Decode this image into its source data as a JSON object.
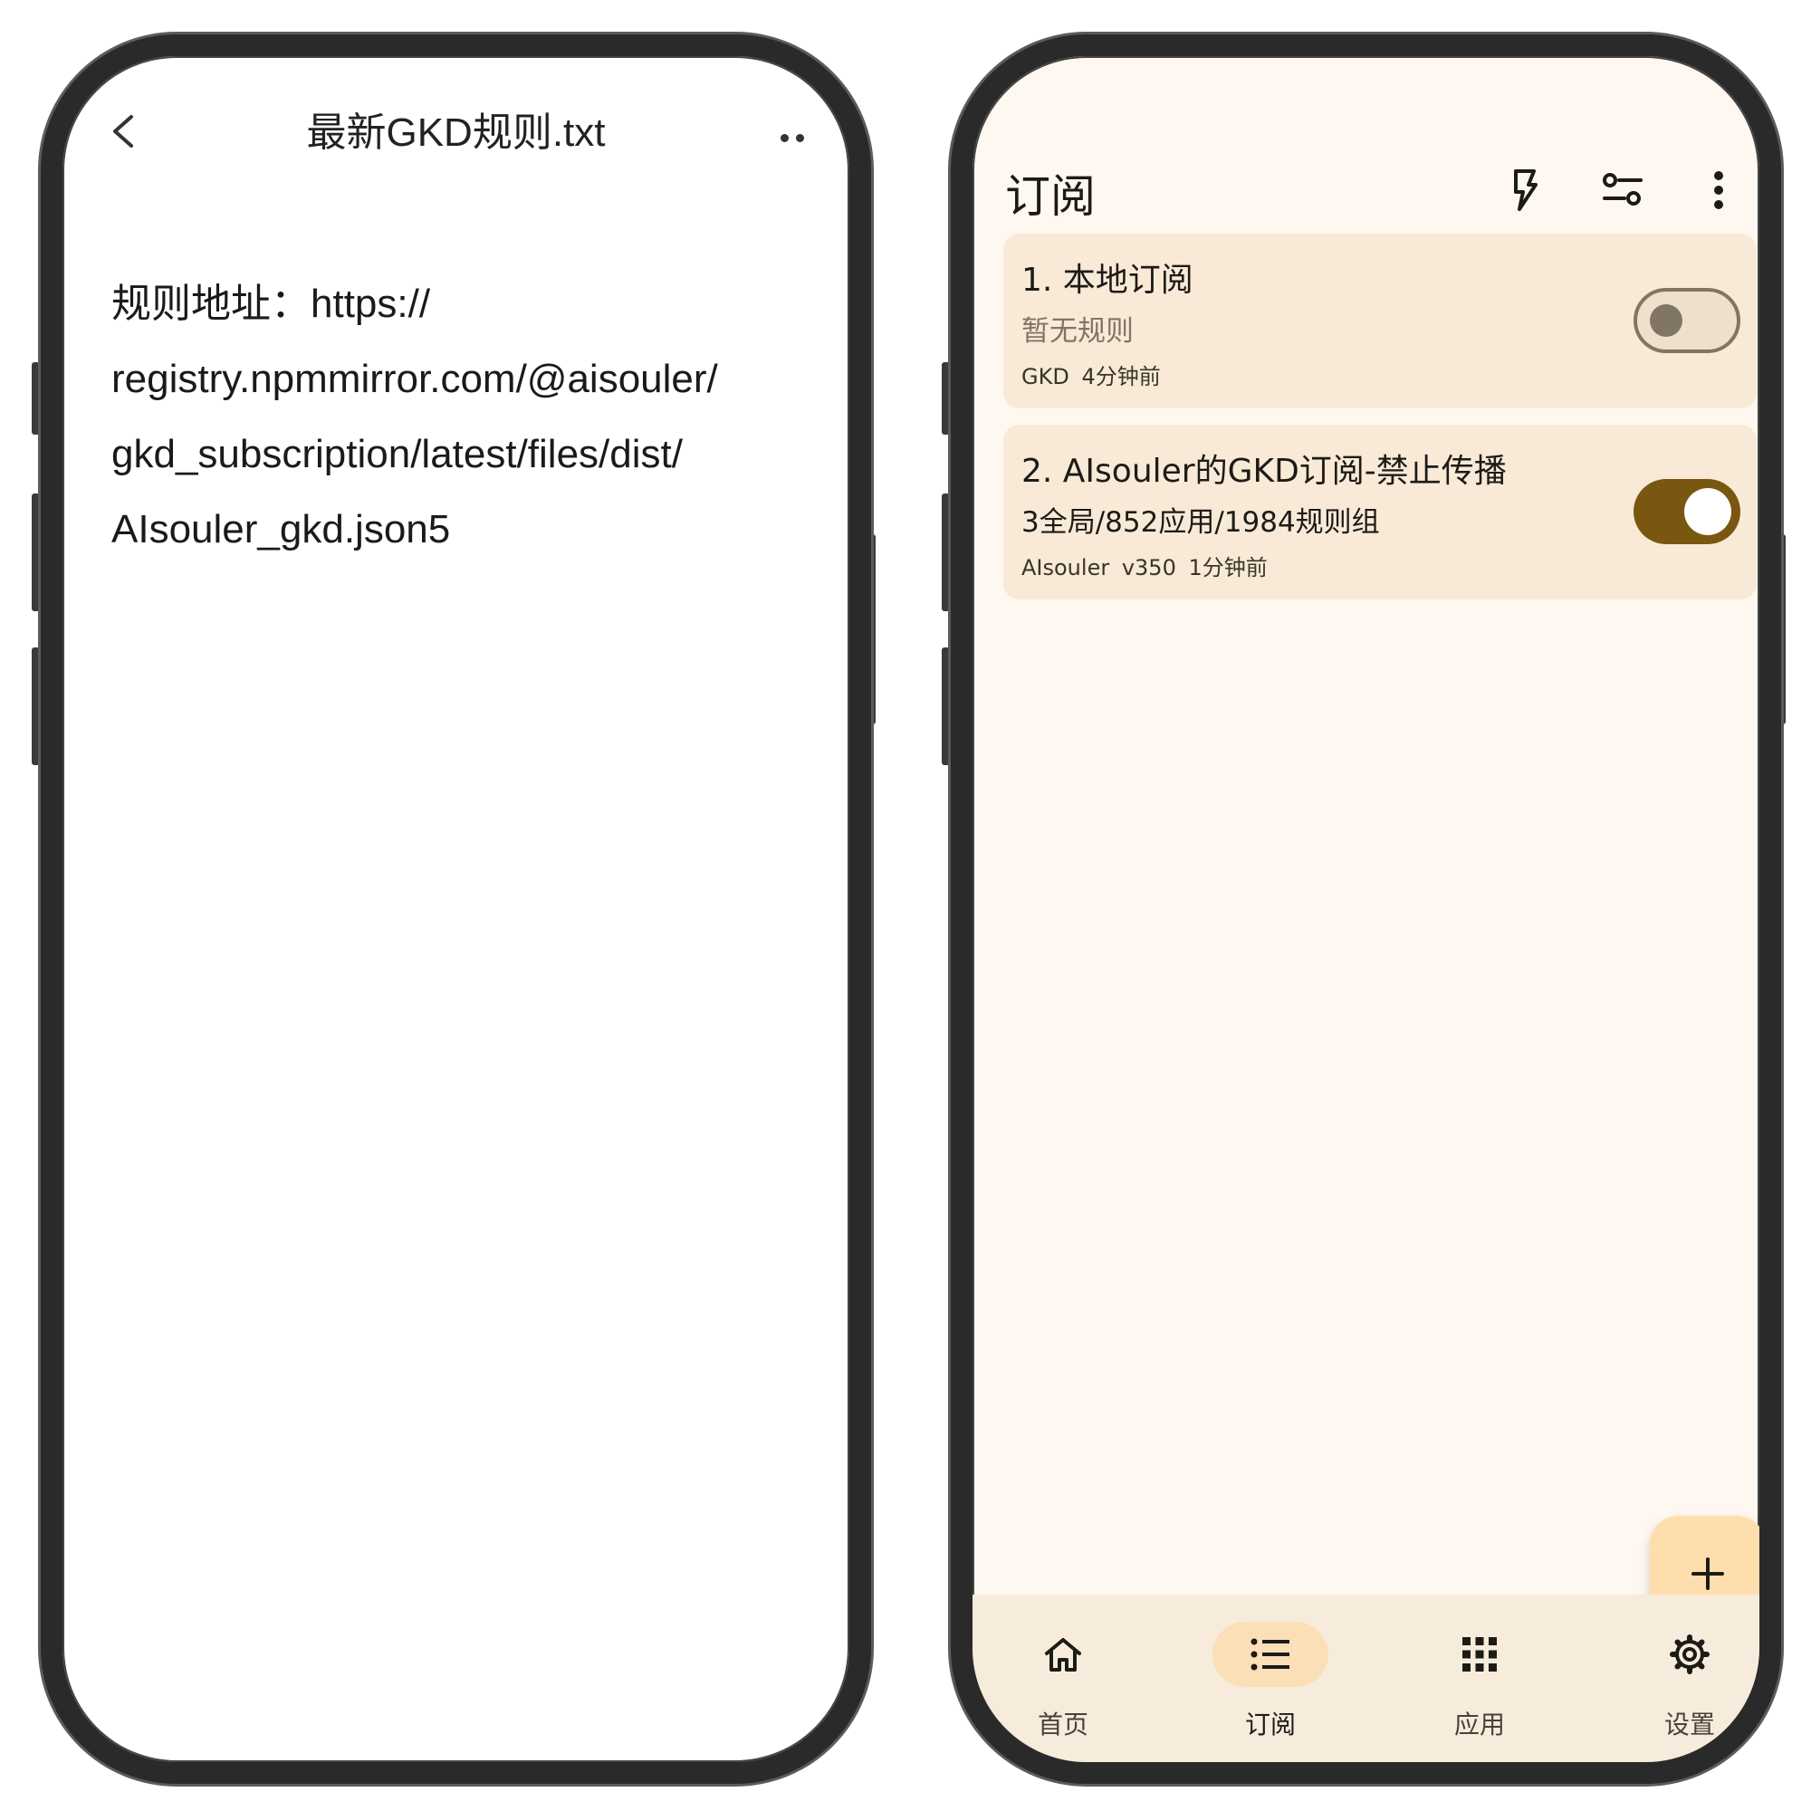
{
  "left_screen": {
    "title": "最新GKD规则.txt",
    "body_lines": [
      "规则地址：https://",
      "registry.npmmirror.com/@aisouler/",
      "gkd_subscription/latest/files/dist/",
      "AIsouler_gkd.json5"
    ]
  },
  "right_screen": {
    "app_bar": {
      "title": "订阅",
      "icons": [
        "flash-icon",
        "filter-settings-icon",
        "more-vert-icon"
      ]
    },
    "subscriptions": [
      {
        "title": "1. 本地订阅",
        "subtitle": "暂无规则",
        "meta": "GKD   4分钟前",
        "enabled": false
      },
      {
        "title": "2. AIsouler的GKD订阅-禁止传播",
        "subtitle": "3全局/852应用/1984规则组",
        "meta": "AIsouler   v350   1分钟前",
        "enabled": true
      }
    ],
    "fab_icon": "plus-icon",
    "bottom_nav": [
      {
        "label": "首页",
        "icon": "home-icon",
        "active": false
      },
      {
        "label": "订阅",
        "icon": "list-icon",
        "active": true
      },
      {
        "label": "应用",
        "icon": "apps-grid-icon",
        "active": false
      },
      {
        "label": "设置",
        "icon": "gear-icon",
        "active": false
      }
    ]
  },
  "colors": {
    "accent": "#7a5710",
    "card_bg": "#f8ead7",
    "screen_bg": "#fef8f0",
    "fab_bg": "#ffdeae",
    "nav_active_pill": "#fbdfb6"
  }
}
